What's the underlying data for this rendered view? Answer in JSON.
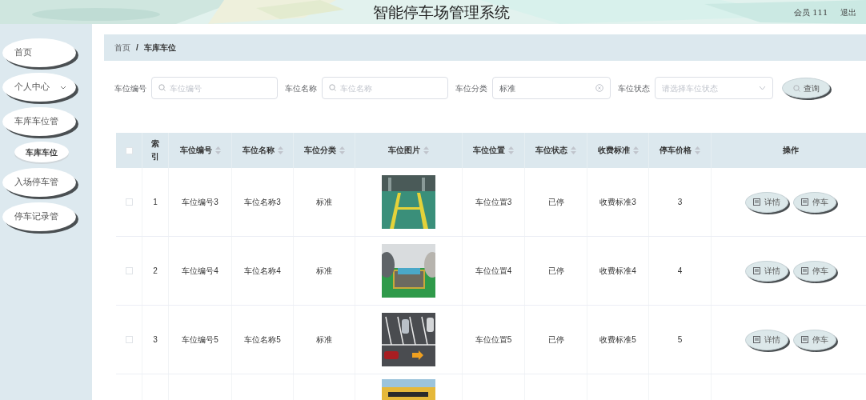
{
  "header": {
    "title": "智能停车场管理系统",
    "user": "会员 111",
    "logout": "退出"
  },
  "sidebar": {
    "items": [
      {
        "label": "首页",
        "selected": false,
        "expandable": false
      },
      {
        "label": "个人中心",
        "selected": false,
        "expandable": true
      },
      {
        "label": "车库车位管",
        "selected": false,
        "expandable": false,
        "children": [
          {
            "label": "车库车位",
            "selected": true
          }
        ]
      },
      {
        "label": "入场停车管",
        "selected": false,
        "expandable": false
      },
      {
        "label": "停车记录管",
        "selected": false,
        "expandable": false
      }
    ]
  },
  "breadcrumb": [
    "首页",
    "车库车位"
  ],
  "breadcrumb_separator": "/",
  "filters": [
    {
      "kind": "input",
      "label": "车位编号",
      "placeholder": "车位编号"
    },
    {
      "kind": "input",
      "label": "车位名称",
      "placeholder": "车位名称"
    },
    {
      "kind": "select",
      "label": "车位分类",
      "value": "标准",
      "clearable": true
    },
    {
      "kind": "select",
      "label": "车位状态",
      "placeholder": "请选择车位状态",
      "clearable": false
    }
  ],
  "search_button": "查询",
  "table": {
    "select_all_checked": false,
    "columns": [
      {
        "label": "索引",
        "sortable": false
      },
      {
        "label": "车位编号",
        "sortable": true
      },
      {
        "label": "车位名称",
        "sortable": true
      },
      {
        "label": "车位分类",
        "sortable": true
      },
      {
        "label": "车位图片",
        "sortable": true
      },
      {
        "label": "车位位置",
        "sortable": true
      },
      {
        "label": "车位状态",
        "sortable": true
      },
      {
        "label": "收费标准",
        "sortable": true
      },
      {
        "label": "停车价格",
        "sortable": true
      },
      {
        "label": "操作",
        "sortable": false
      }
    ],
    "rows": [
      {
        "kind": "full",
        "checked": false,
        "index": "1",
        "code": "车位编号3",
        "name": "车位名称3",
        "category": "标准",
        "location": "车位位置3",
        "status": "已停",
        "fee": "收费标准3",
        "price": "3",
        "actions": [
          "详情",
          "停车"
        ]
      },
      {
        "kind": "full",
        "checked": false,
        "index": "2",
        "code": "车位编号4",
        "name": "车位名称4",
        "category": "标准",
        "location": "车位位置4",
        "status": "已停",
        "fee": "收费标准4",
        "price": "4",
        "actions": [
          "详情",
          "停车"
        ]
      },
      {
        "kind": "full",
        "checked": false,
        "index": "3",
        "code": "车位编号5",
        "name": "车位名称5",
        "category": "标准",
        "location": "车位位置5",
        "status": "已停",
        "fee": "收费标准5",
        "price": "5",
        "actions": [
          "详情",
          "停车"
        ]
      },
      {
        "kind": "partial"
      }
    ]
  }
}
